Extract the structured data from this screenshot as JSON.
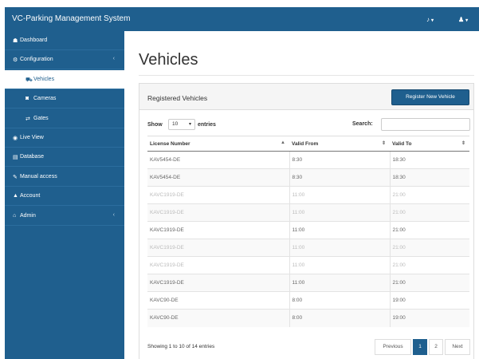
{
  "app": {
    "title": "VC-Parking Management System"
  },
  "topbar": {
    "notifications_icon": "bell-icon",
    "user_icon": "user-icon",
    "caret": "▾"
  },
  "sidebar": {
    "items": [
      {
        "label": "Dashboard",
        "icon": "dashboard-icon",
        "glyph": "☗"
      },
      {
        "label": "Configuration",
        "icon": "gear-icon",
        "glyph": "⚙",
        "arrow": "‹"
      },
      {
        "label": "Vehicles",
        "icon": "car-icon",
        "glyph": "⛟",
        "active": true,
        "sub": true
      },
      {
        "label": "Cameras",
        "icon": "camera-icon",
        "glyph": "◙",
        "sub": true
      },
      {
        "label": "Gates",
        "icon": "gate-icon",
        "glyph": "⇄",
        "sub": true
      },
      {
        "label": "Live View",
        "icon": "eye-icon",
        "glyph": "◉"
      },
      {
        "label": "Database",
        "icon": "database-icon",
        "glyph": "▤"
      },
      {
        "label": "Manual access",
        "icon": "wrench-icon",
        "glyph": "✎"
      },
      {
        "label": "Account",
        "icon": "user-icon",
        "glyph": "▲"
      },
      {
        "label": "Admin",
        "icon": "home-icon",
        "glyph": "⌂",
        "arrow": "‹"
      }
    ]
  },
  "main": {
    "page_title": "Vehicles",
    "panel": {
      "title": "Registered Vehicles",
      "add_button": "Register New Vehicle",
      "length": {
        "before": "Show",
        "value": "10",
        "after": "entries"
      },
      "search_label": "Search:",
      "search_value": "",
      "columns": [
        "License Number",
        "Valid From",
        "Valid To"
      ],
      "sort_icons": [
        "▲",
        "⇕",
        "⇕"
      ],
      "rows": [
        {
          "plate": "KAV5454-DE",
          "from": "8:30",
          "to": "18:30",
          "faded": false
        },
        {
          "plate": "KAV5454-DE",
          "from": "8:30",
          "to": "18:30",
          "faded": false
        },
        {
          "plate": "KAVC1919-DE",
          "from": "11:00",
          "to": "21:00",
          "faded": true
        },
        {
          "plate": "KAVC1919-DE",
          "from": "11:00",
          "to": "21:00",
          "faded": true
        },
        {
          "plate": "KAVC1919-DE",
          "from": "11:00",
          "to": "21:00",
          "faded": false
        },
        {
          "plate": "KAVC1919-DE",
          "from": "11:00",
          "to": "21:00",
          "faded": true
        },
        {
          "plate": "KAVC1919-DE",
          "from": "11:00",
          "to": "21:00",
          "faded": true
        },
        {
          "plate": "KAVC1919-DE",
          "from": "11:00",
          "to": "21:00",
          "faded": false
        },
        {
          "plate": "KAVC90-DE",
          "from": "8:00",
          "to": "19:00",
          "faded": false
        },
        {
          "plate": "KAVC90-DE",
          "from": "8:00",
          "to": "19:00",
          "faded": false
        }
      ],
      "info": "Showing 1 to 10 of 14 entries",
      "pagination": {
        "previous": "Previous",
        "pages": [
          "1",
          "2"
        ],
        "current": "1",
        "next": "Next"
      }
    }
  },
  "colors": {
    "brand": "#1f5f8e",
    "panel_head": "#f5f5f5",
    "border": "#dddddd"
  }
}
